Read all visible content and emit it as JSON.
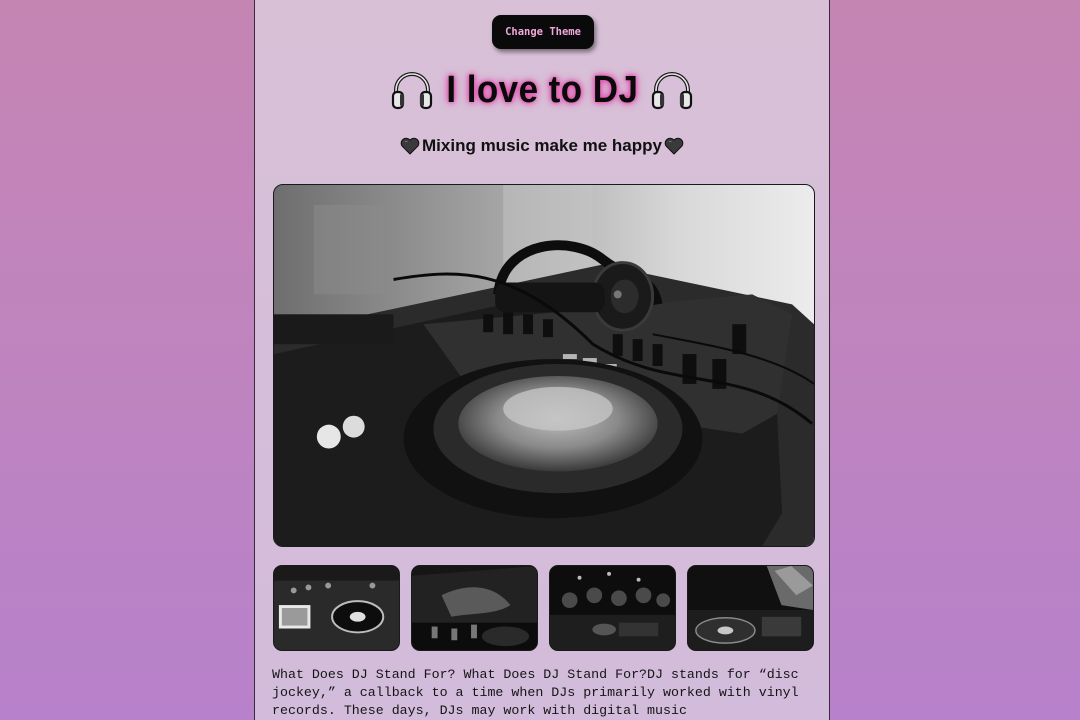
{
  "header": {
    "theme_button_label": "Change Theme"
  },
  "title": {
    "text": "I love to DJ",
    "left_icon": "headphones-icon",
    "right_icon": "headphones-icon"
  },
  "subtitle": {
    "text": "Mixing music make me happy",
    "left_icon": "black-heart-icon",
    "right_icon": "black-heart-icon"
  },
  "gallery": {
    "hero_image": "dj-deck-with-headphones-photo",
    "thumbnails": [
      "dj-controller-photo",
      "hand-on-mixer-photo",
      "crowd-at-dj-booth-photo",
      "dj-at-turntable-photo"
    ]
  },
  "article": {
    "text": "What Does DJ Stand For? What Does DJ Stand For?DJ stands for “disc jockey,” a callback to a time when DJs primarily worked with vinyl records. These days, DJs may work with digital music"
  },
  "colors": {
    "page_gradient_top": "#c585b3",
    "page_gradient_bottom": "#b781cb",
    "card_background": "#d8c1d7",
    "title_glow": "#e23ca6",
    "button_background": "#0a0a0a",
    "button_text": "#f0a8dc"
  }
}
